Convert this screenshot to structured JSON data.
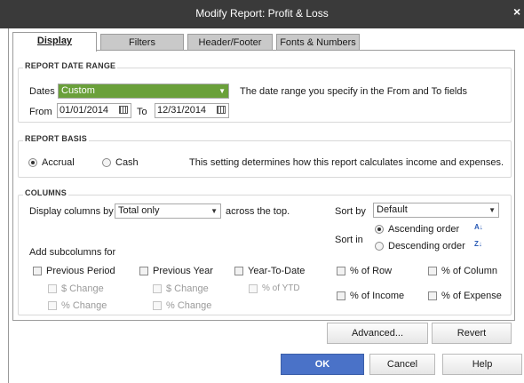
{
  "window": {
    "title": "Modify Report: Profit & Loss",
    "close_glyph": "×"
  },
  "tabs": [
    {
      "label": "Display",
      "active": true
    },
    {
      "label": "Filters",
      "active": false
    },
    {
      "label": "Header/Footer",
      "active": false
    },
    {
      "label": "Fonts & Numbers",
      "active": false
    }
  ],
  "date_range": {
    "section_title": "REPORT DATE RANGE",
    "dates_label": "Dates",
    "dates_value": "Custom",
    "dates_highlight": "#6aa03a",
    "hint": "The date range you specify in the From and To fields",
    "from_label": "From",
    "from_value": "01/01/2014",
    "to_label": "To",
    "to_value": "12/31/2014"
  },
  "report_basis": {
    "section_title": "REPORT BASIS",
    "accrual_label": "Accrual",
    "cash_label": "Cash",
    "selected": "Accrual",
    "description": "This setting determines how this report calculates income and expenses."
  },
  "columns": {
    "section_title": "COLUMNS",
    "display_columns_label": "Display columns by",
    "display_columns_value": "Total only",
    "across_label": "across the top.",
    "sort_by_label": "Sort by",
    "sort_by_value": "Default",
    "sort_in_label": "Sort in",
    "ascending_label": "Ascending order",
    "descending_label": "Descending order",
    "sort_selected": "Ascending order",
    "ascending_icon_glyph": "A↓",
    "descending_icon_glyph": "Z↓",
    "add_subcolumns_label": "Add subcolumns for",
    "previous_period": "Previous Period",
    "previous_year": "Previous Year",
    "ytd": "Year-To-Date",
    "pp_dollar_change": "$ Change",
    "pp_pct_change": "% Change",
    "py_dollar_change": "$ Change",
    "py_pct_change": "% Change",
    "pct_of_ytd": "% of YTD",
    "pct_of_row": "% of Row",
    "pct_of_column": "% of Column",
    "pct_of_income": "% of Income",
    "pct_of_expense": "% of Expense"
  },
  "buttons": {
    "advanced": "Advanced...",
    "revert": "Revert",
    "ok": "OK",
    "cancel": "Cancel",
    "help": "Help"
  },
  "colors": {
    "titlebar": "#3a3a3a",
    "ok_button": "#4a72c8",
    "dates_highlight": "#6aa03a"
  }
}
